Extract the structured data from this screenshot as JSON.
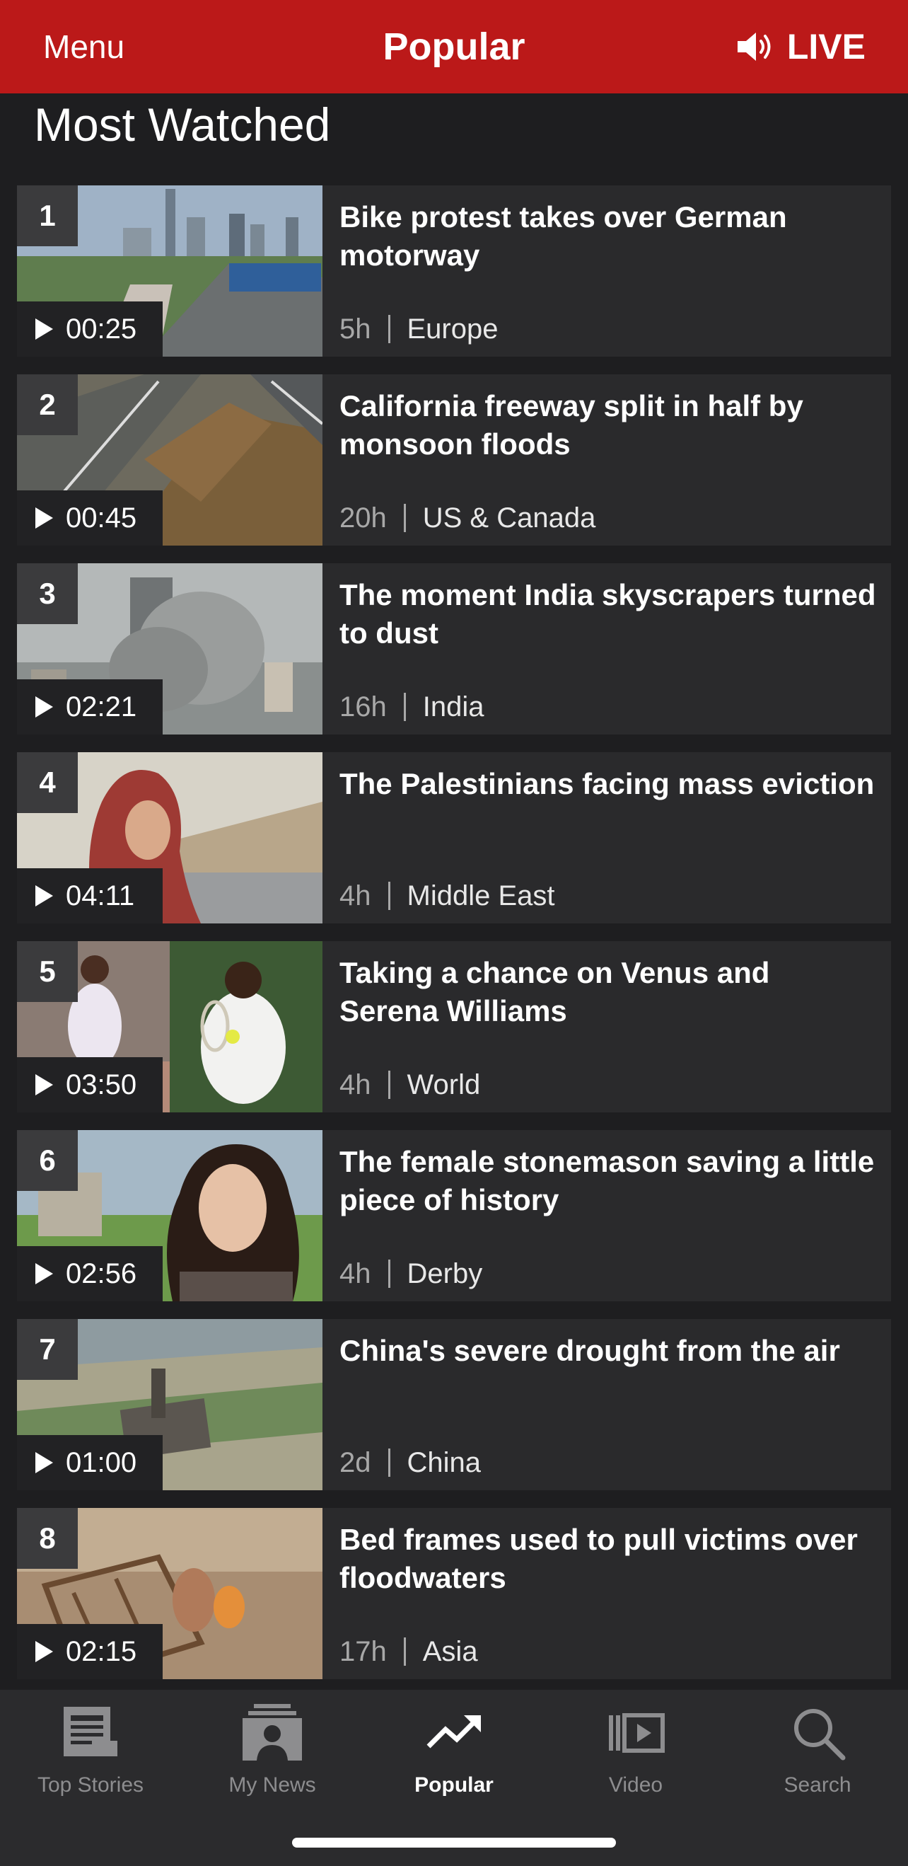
{
  "header": {
    "menu_label": "Menu",
    "title": "Popular",
    "live_label": "LIVE"
  },
  "section": {
    "title": "Most Watched"
  },
  "items": [
    {
      "rank": "1",
      "duration": "00:25",
      "headline": "Bike protest takes over German motorway",
      "age": "5h",
      "category": "Europe"
    },
    {
      "rank": "2",
      "duration": "00:45",
      "headline": "California freeway split in half by monsoon floods",
      "age": "20h",
      "category": "US & Canada"
    },
    {
      "rank": "3",
      "duration": "02:21",
      "headline": "The moment India skyscrapers turned to dust",
      "age": "16h",
      "category": "India"
    },
    {
      "rank": "4",
      "duration": "04:11",
      "headline": "The Palestinians facing mass eviction",
      "age": "4h",
      "category": "Middle East"
    },
    {
      "rank": "5",
      "duration": "03:50",
      "headline": "Taking a chance on Venus and Serena Williams",
      "age": "4h",
      "category": "World"
    },
    {
      "rank": "6",
      "duration": "02:56",
      "headline": "The female stonemason saving a little piece of history",
      "age": "4h",
      "category": "Derby"
    },
    {
      "rank": "7",
      "duration": "01:00",
      "headline": "China's severe drought from the air",
      "age": "2d",
      "category": "China"
    },
    {
      "rank": "8",
      "duration": "02:15",
      "headline": "Bed frames used to pull victims over floodwaters",
      "age": "17h",
      "category": "Asia"
    }
  ],
  "tabs": [
    {
      "label": "Top Stories",
      "icon": "newspaper-icon"
    },
    {
      "label": "My News",
      "icon": "my-news-icon"
    },
    {
      "label": "Popular",
      "icon": "trending-icon"
    },
    {
      "label": "Video",
      "icon": "video-icon"
    },
    {
      "label": "Search",
      "icon": "search-icon"
    }
  ],
  "colors": {
    "brand_red": "#bb1919",
    "background": "#1e1e20",
    "card": "#2a2a2c"
  }
}
